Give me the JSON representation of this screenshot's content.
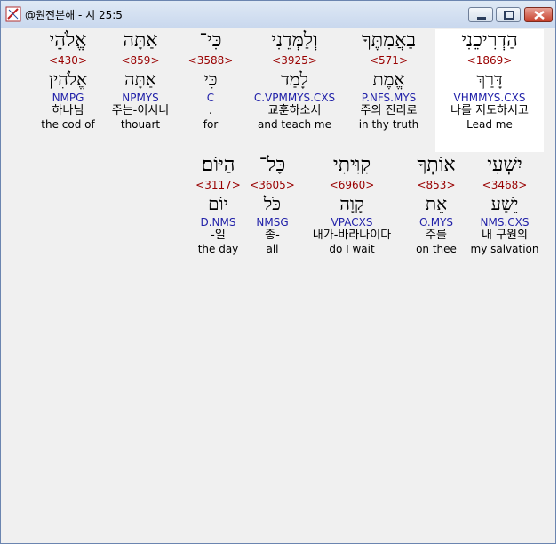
{
  "window": {
    "title": "@원전본해 - 시 25:5"
  },
  "rows": [
    [
      {
        "heb": "הַדְרִיכֵנִי",
        "strong": "<1869>",
        "lemma": "דָּרַךְ",
        "morph": "VHMMYS.CXS",
        "kor": "나를 지도하시고",
        "eng": "Lead me",
        "selected": true
      },
      {
        "heb": "בַאֲמִתֶּךָ",
        "strong": "<571>",
        "lemma": "אֱמֶת",
        "morph": "P.NFS.MYS",
        "kor": "주의 진리로",
        "eng": "in thy truth"
      },
      {
        "heb": "וְלַמְּדֵנִי",
        "strong": "<3925>",
        "lemma": "לָמַד",
        "morph": "C.VPMMYS.CXS",
        "kor": "교훈하소서",
        "eng": "and teach me"
      },
      {
        "heb": "כִּי־",
        "strong": "<3588>",
        "lemma": "כִּי",
        "morph": "C",
        "kor": ".",
        "eng": "for"
      },
      {
        "heb": "אַתָּה",
        "strong": "<859>",
        "lemma": "אַתָּה",
        "morph": "NPMYS",
        "kor": "주는-이시니",
        "eng": "thouart"
      },
      {
        "heb": "אֱלֹהֵי",
        "strong": "<430>",
        "lemma": "אֱלֹהִין",
        "morph": "NMPG",
        "kor": "하나님",
        "eng": "the cod of"
      }
    ],
    [
      {
        "heb": "יִשְׁעִי",
        "strong": "<3468>",
        "lemma": "יֵשַׁע",
        "morph": "NMS.CXS",
        "kor": "내 구원의",
        "eng": "my salvation"
      },
      {
        "heb": "אוֹתְךָ",
        "strong": "<853>",
        "lemma": "אֵת",
        "morph": "O.MYS",
        "kor": "주를",
        "eng": "on thee"
      },
      {
        "heb": "קִוִּיתִי",
        "strong": "<6960>",
        "lemma": "קָוָה",
        "morph": "VPACXS",
        "kor": "내가-바라나이다",
        "eng": "do I wait"
      },
      {
        "heb": "כָּל־",
        "strong": "<3605>",
        "lemma": "כֹּל",
        "morph": "NMSG",
        "kor": "종-",
        "eng": "all"
      },
      {
        "heb": "הַיּוֹם׃",
        "strong": "<3117>",
        "lemma": "יוֹם",
        "morph": "D.NMS",
        "kor": "-일",
        "eng": "the day"
      }
    ]
  ]
}
